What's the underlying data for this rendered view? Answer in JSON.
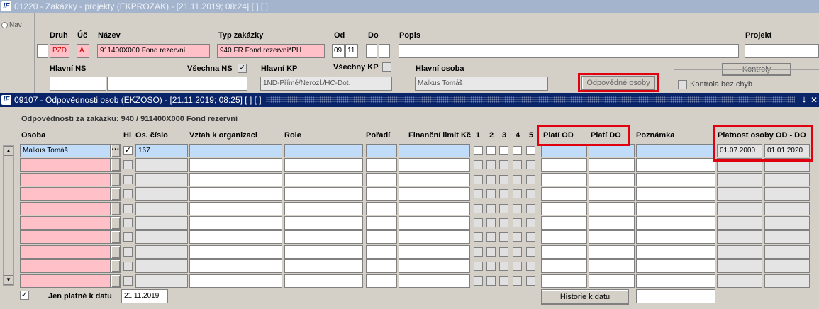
{
  "outer_window": {
    "title": "01220 - Zakázky - projekty (EKPROZAK) - [21.11.2019; 08:24]  [ ]  [ ]",
    "nav_label": "Nav"
  },
  "header_form": {
    "druh_label": "Druh",
    "druh_value": "PZD",
    "uc_label": "Úč",
    "uc_value": "A",
    "nazev_label": "Název",
    "nazev_value": "911400X000 Fond rezervní",
    "typ_label": "Typ zakázky",
    "typ_value": "940 FR Fond rezervní*PH",
    "od_label": "Od",
    "od_v1": "09",
    "od_v2": "11",
    "do_label": "Do",
    "popis_label": "Popis",
    "projekt_label": "Projekt",
    "hlavni_ns_label": "Hlavní NS",
    "vsechna_ns_label": "Všechna NS",
    "hlavni_kp_label": "Hlavní KP",
    "hlavni_kp_value": "1ND-Přímé/Nerozl./HČ-Dot.",
    "vsechny_kp_label": "Všechny KP",
    "hlavni_osoba_label": "Hlavní osoba",
    "hlavni_osoba_value": "Malkus Tomáš",
    "odpovedne_osoby_button": "Odpovědné osoby",
    "kontroly_button": "Kontroly",
    "kontrola_bez_chyb": "Kontrola bez chyb"
  },
  "inner_window": {
    "title": "09107 - Odpovědnosti osob (EKZOSO) - [21.11.2019; 08:25]  [ ]  [ ]",
    "subtitle": "Odpovědnosti za zakázku: 940 / 911400X000 Fond rezervní",
    "columns": {
      "osoba": "Osoba",
      "hl": "Hl",
      "os_cislo": "Os. číslo",
      "vztah": "Vztah k organizaci",
      "role": "Role",
      "poradi": "Pořadí",
      "fin_limit": "Finanční limit Kč",
      "c1": "1",
      "c2": "2",
      "c3": "3",
      "c4": "4",
      "c5": "5",
      "plati_od": "Platí OD",
      "plati_do": "Platí DO",
      "poznamka": "Poznámka",
      "platnost": "Platnost osoby OD - DO"
    },
    "rows": [
      {
        "osoba": "Malkus Tomáš",
        "hl": true,
        "os_cislo": "167",
        "platnost_od": "01.07.2000",
        "platnost_do": "01.01.2020"
      },
      {},
      {},
      {},
      {},
      {},
      {},
      {},
      {},
      {}
    ],
    "jen_platne_label": "Jen platné k datu",
    "jen_platne_date": "21.11.2019",
    "historie_button": "Historie k datu",
    "ellipsis": "···"
  }
}
